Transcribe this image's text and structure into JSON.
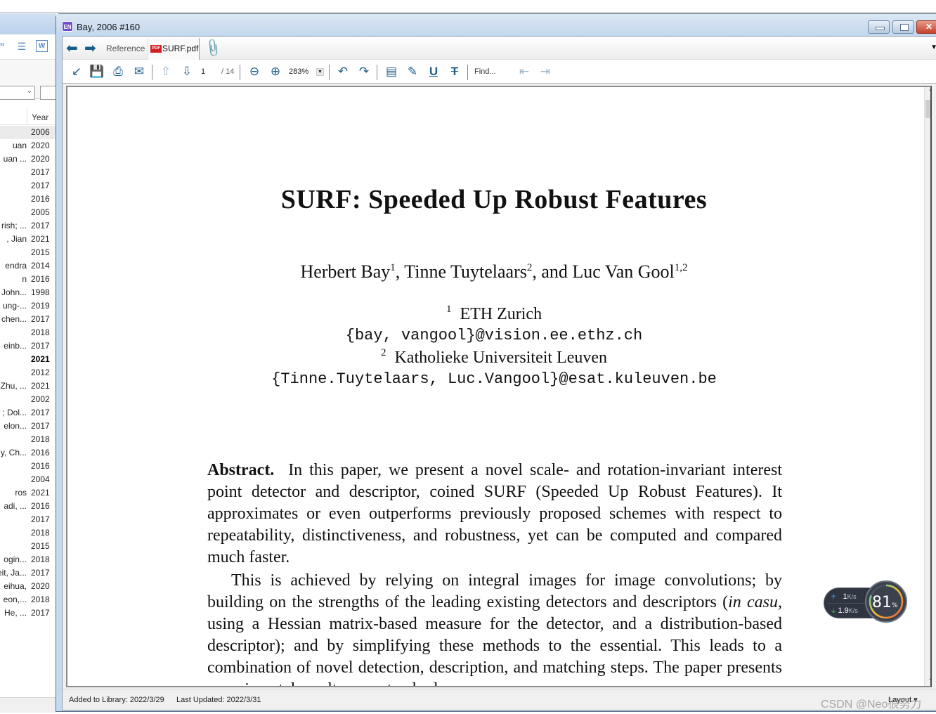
{
  "window": {
    "title": "Bay, 2006 #160",
    "app_icon_label": "EN"
  },
  "left_pane": {
    "toolbar_icons": [
      "quote-icon",
      "edit-icon",
      "word-icon"
    ],
    "column_header_year": "Year",
    "rows": [
      {
        "author": "",
        "year": "2006",
        "selected": true,
        "bold": false
      },
      {
        "author": "uan",
        "year": "2020",
        "selected": false,
        "bold": false
      },
      {
        "author": "uan ...",
        "year": "2020",
        "selected": false,
        "bold": false
      },
      {
        "author": "",
        "year": "2017",
        "selected": false,
        "bold": false
      },
      {
        "author": "",
        "year": "2017",
        "selected": false,
        "bold": false
      },
      {
        "author": "",
        "year": "2016",
        "selected": false,
        "bold": false
      },
      {
        "author": "",
        "year": "2005",
        "selected": false,
        "bold": false
      },
      {
        "author": "rish; ...",
        "year": "2017",
        "selected": false,
        "bold": false
      },
      {
        "author": ", Jian",
        "year": "2021",
        "selected": false,
        "bold": false
      },
      {
        "author": "",
        "year": "2015",
        "selected": false,
        "bold": false
      },
      {
        "author": "endra",
        "year": "2014",
        "selected": false,
        "bold": false
      },
      {
        "author": "n",
        "year": "2016",
        "selected": false,
        "bold": false
      },
      {
        "author": "John...",
        "year": "1998",
        "selected": false,
        "bold": false
      },
      {
        "author": "ung-...",
        "year": "2019",
        "selected": false,
        "bold": false
      },
      {
        "author": "chen...",
        "year": "2017",
        "selected": false,
        "bold": false
      },
      {
        "author": "",
        "year": "2018",
        "selected": false,
        "bold": false
      },
      {
        "author": "einb...",
        "year": "2017",
        "selected": false,
        "bold": false
      },
      {
        "author": "",
        "year": "2021",
        "selected": false,
        "bold": true
      },
      {
        "author": "",
        "year": "2012",
        "selected": false,
        "bold": false
      },
      {
        "author": "Zhu, ...",
        "year": "2021",
        "selected": false,
        "bold": false
      },
      {
        "author": "",
        "year": "2002",
        "selected": false,
        "bold": false
      },
      {
        "author": "; Dol...",
        "year": "2017",
        "selected": false,
        "bold": false
      },
      {
        "author": "elon...",
        "year": "2017",
        "selected": false,
        "bold": false
      },
      {
        "author": "",
        "year": "2018",
        "selected": false,
        "bold": false
      },
      {
        "author": "y, Ch...",
        "year": "2016",
        "selected": false,
        "bold": false
      },
      {
        "author": "",
        "year": "2016",
        "selected": false,
        "bold": false
      },
      {
        "author": "",
        "year": "2004",
        "selected": false,
        "bold": false
      },
      {
        "author": "ros",
        "year": "2021",
        "selected": false,
        "bold": false
      },
      {
        "author": "adi, ...",
        "year": "2016",
        "selected": false,
        "bold": false
      },
      {
        "author": "",
        "year": "2017",
        "selected": false,
        "bold": false
      },
      {
        "author": "",
        "year": "2018",
        "selected": false,
        "bold": false
      },
      {
        "author": "",
        "year": "2015",
        "selected": false,
        "bold": false
      },
      {
        "author": "ogin...",
        "year": "2018",
        "selected": false,
        "bold": false
      },
      {
        "author": "eit, Ja...",
        "year": "2017",
        "selected": false,
        "bold": false
      },
      {
        "author": "eihua,",
        "year": "2020",
        "selected": false,
        "bold": false
      },
      {
        "author": "eon,...",
        "year": "2018",
        "selected": false,
        "bold": false
      },
      {
        "author": "He, ...",
        "year": "2017",
        "selected": false,
        "bold": false
      }
    ]
  },
  "tabs": {
    "reference_label": "Reference",
    "pdf_label": "SURF.pdf",
    "pdf_badge": "PDF"
  },
  "pdf_toolbar": {
    "current_page": "1",
    "total_pages": "/ 14",
    "zoom_level": "283%",
    "find_placeholder": "Find..."
  },
  "paper": {
    "title": "SURF: Speeded Up Robust Features",
    "authors": [
      {
        "name": "Herbert Bay",
        "sup": "1",
        "sep": ", "
      },
      {
        "name": "Tinne Tuytelaars",
        "sup": "2",
        "sep": ", and "
      },
      {
        "name": "Luc Van Gool",
        "sup": "1,2",
        "sep": ""
      }
    ],
    "affiliation1_sup": "1",
    "affiliation1": "ETH Zurich",
    "email1": "{bay, vangool}@vision.ee.ethz.ch",
    "affiliation2_sup": "2",
    "affiliation2": "Katholieke Universiteit Leuven",
    "email2": "{Tinne.Tuytelaars, Luc.Vangool}@esat.kuleuven.be",
    "abstract_label": "Abstract.",
    "abstract_p1": "In this paper, we present a novel scale- and rotation-invariant interest point detector and descriptor, coined SURF (Speeded Up Robust Features). It approximates or even outperforms previously proposed schemes with respect to repeatability, distinctiveness, and robustness, yet can be computed and compared much faster.",
    "abstract_p2_a": "This is achieved by relying on integral images for image convolutions; by building on the strengths of the leading existing detectors and descriptors (",
    "abstract_p2_italic": "in casu",
    "abstract_p2_b": ", using a Hessian matrix-based measure for the detector, and a distribution-based descriptor); and by simplifying these methods to the essential. This leads to a combination of novel detection, description, and matching steps. The paper presents experimental results on a standard"
  },
  "status": {
    "added": "Added to Library: 2022/3/29",
    "updated": "Last Updated: 2022/3/31",
    "layout_label": "Layout"
  },
  "net_widget": {
    "upload_value": "1",
    "upload_unit": "K/s",
    "download_value": "1.9",
    "download_unit": "K/s",
    "usage_percent": 81,
    "usage_label": "81",
    "usage_unit": "%"
  },
  "watermark": "CSDN @Neo很努力"
}
